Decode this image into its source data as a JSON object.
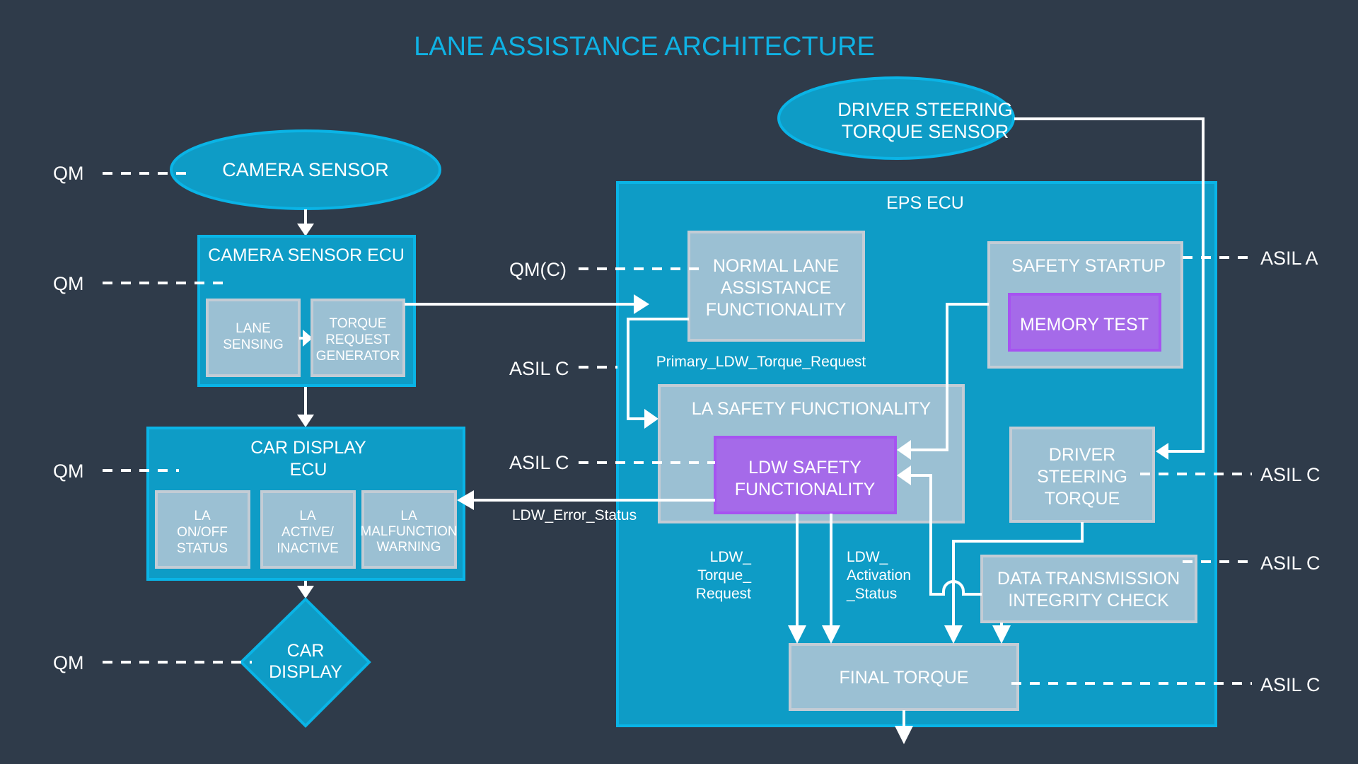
{
  "title": "LANE ASSISTANCE ARCHITECTURE",
  "colors": {
    "background": "#2f3b4a",
    "title": "#0fb2e4",
    "ecu_blue": "#0e9cc6",
    "component_grey": "#9bc0d3",
    "safety_purple": "#a56ae9",
    "lines": "#ffffff"
  },
  "nodes": {
    "camera_sensor": {
      "lines": [
        "CAMERA SENSOR"
      ]
    },
    "camera_sensor_ecu": {
      "lines": [
        "CAMERA SENSOR ECU"
      ]
    },
    "lane_sensing": {
      "lines": [
        "LANE",
        "SENSING"
      ]
    },
    "torque_request_generator": {
      "lines": [
        "TORQUE",
        "REQUEST",
        "GENERATOR"
      ]
    },
    "car_display_ecu": {
      "lines": [
        "CAR DISPLAY",
        "ECU"
      ]
    },
    "la_on_off_status": {
      "lines": [
        "LA",
        "ON/OFF",
        "STATUS"
      ]
    },
    "la_active_inactive": {
      "lines": [
        "LA",
        "ACTIVE/",
        "INACTIVE"
      ]
    },
    "la_malfunction_warning": {
      "lines": [
        "LA",
        "MALFUNCTION",
        "WARNING"
      ]
    },
    "car_display": {
      "lines": [
        "CAR",
        "DISPLAY"
      ]
    },
    "driver_steering_torque_sensor": {
      "lines": [
        "DRIVER STEERING",
        "TORQUE SENSOR"
      ]
    },
    "eps_ecu": {
      "lines": [
        "EPS ECU"
      ]
    },
    "normal_lane_assistance": {
      "lines": [
        "NORMAL LANE",
        "ASSISTANCE",
        "FUNCTIONALITY"
      ]
    },
    "safety_startup": {
      "lines": [
        "SAFETY STARTUP"
      ]
    },
    "memory_test": {
      "lines": [
        "MEMORY TEST"
      ]
    },
    "la_safety_functionality": {
      "lines": [
        "LA SAFETY FUNCTIONALITY"
      ]
    },
    "ldw_safety_functionality": {
      "lines": [
        "LDW SAFETY",
        "FUNCTIONALITY"
      ]
    },
    "driver_steering_torque": {
      "lines": [
        "DRIVER",
        "STEERING",
        "TORQUE"
      ]
    },
    "data_transmission_integrity_check": {
      "lines": [
        "DATA TRANSMISSION",
        "INTEGRITY CHECK"
      ]
    },
    "final_torque": {
      "lines": [
        "FINAL TORQUE"
      ]
    }
  },
  "signals": {
    "primary_ldw_torque_request": "Primary_LDW_Torque_Request",
    "ldw_error_status": "LDW_Error_Status",
    "ldw_torque_request": [
      "LDW_",
      "Torque_",
      "Request"
    ],
    "ldw_activation_status": [
      "LDW_",
      "Activation",
      "_Status"
    ]
  },
  "integrity_levels": {
    "camera_sensor": "QM",
    "camera_sensor_ecu": "QM",
    "car_display_ecu": "QM",
    "car_display": "QM",
    "normal_lane_assistance": "QM(C)",
    "la_safety_functionality": "ASIL C",
    "ldw_safety_functionality": "ASIL C",
    "safety_startup": "ASIL A",
    "driver_steering_torque": "ASIL C",
    "data_transmission_integrity_check": "ASIL C",
    "final_torque": "ASIL C"
  }
}
